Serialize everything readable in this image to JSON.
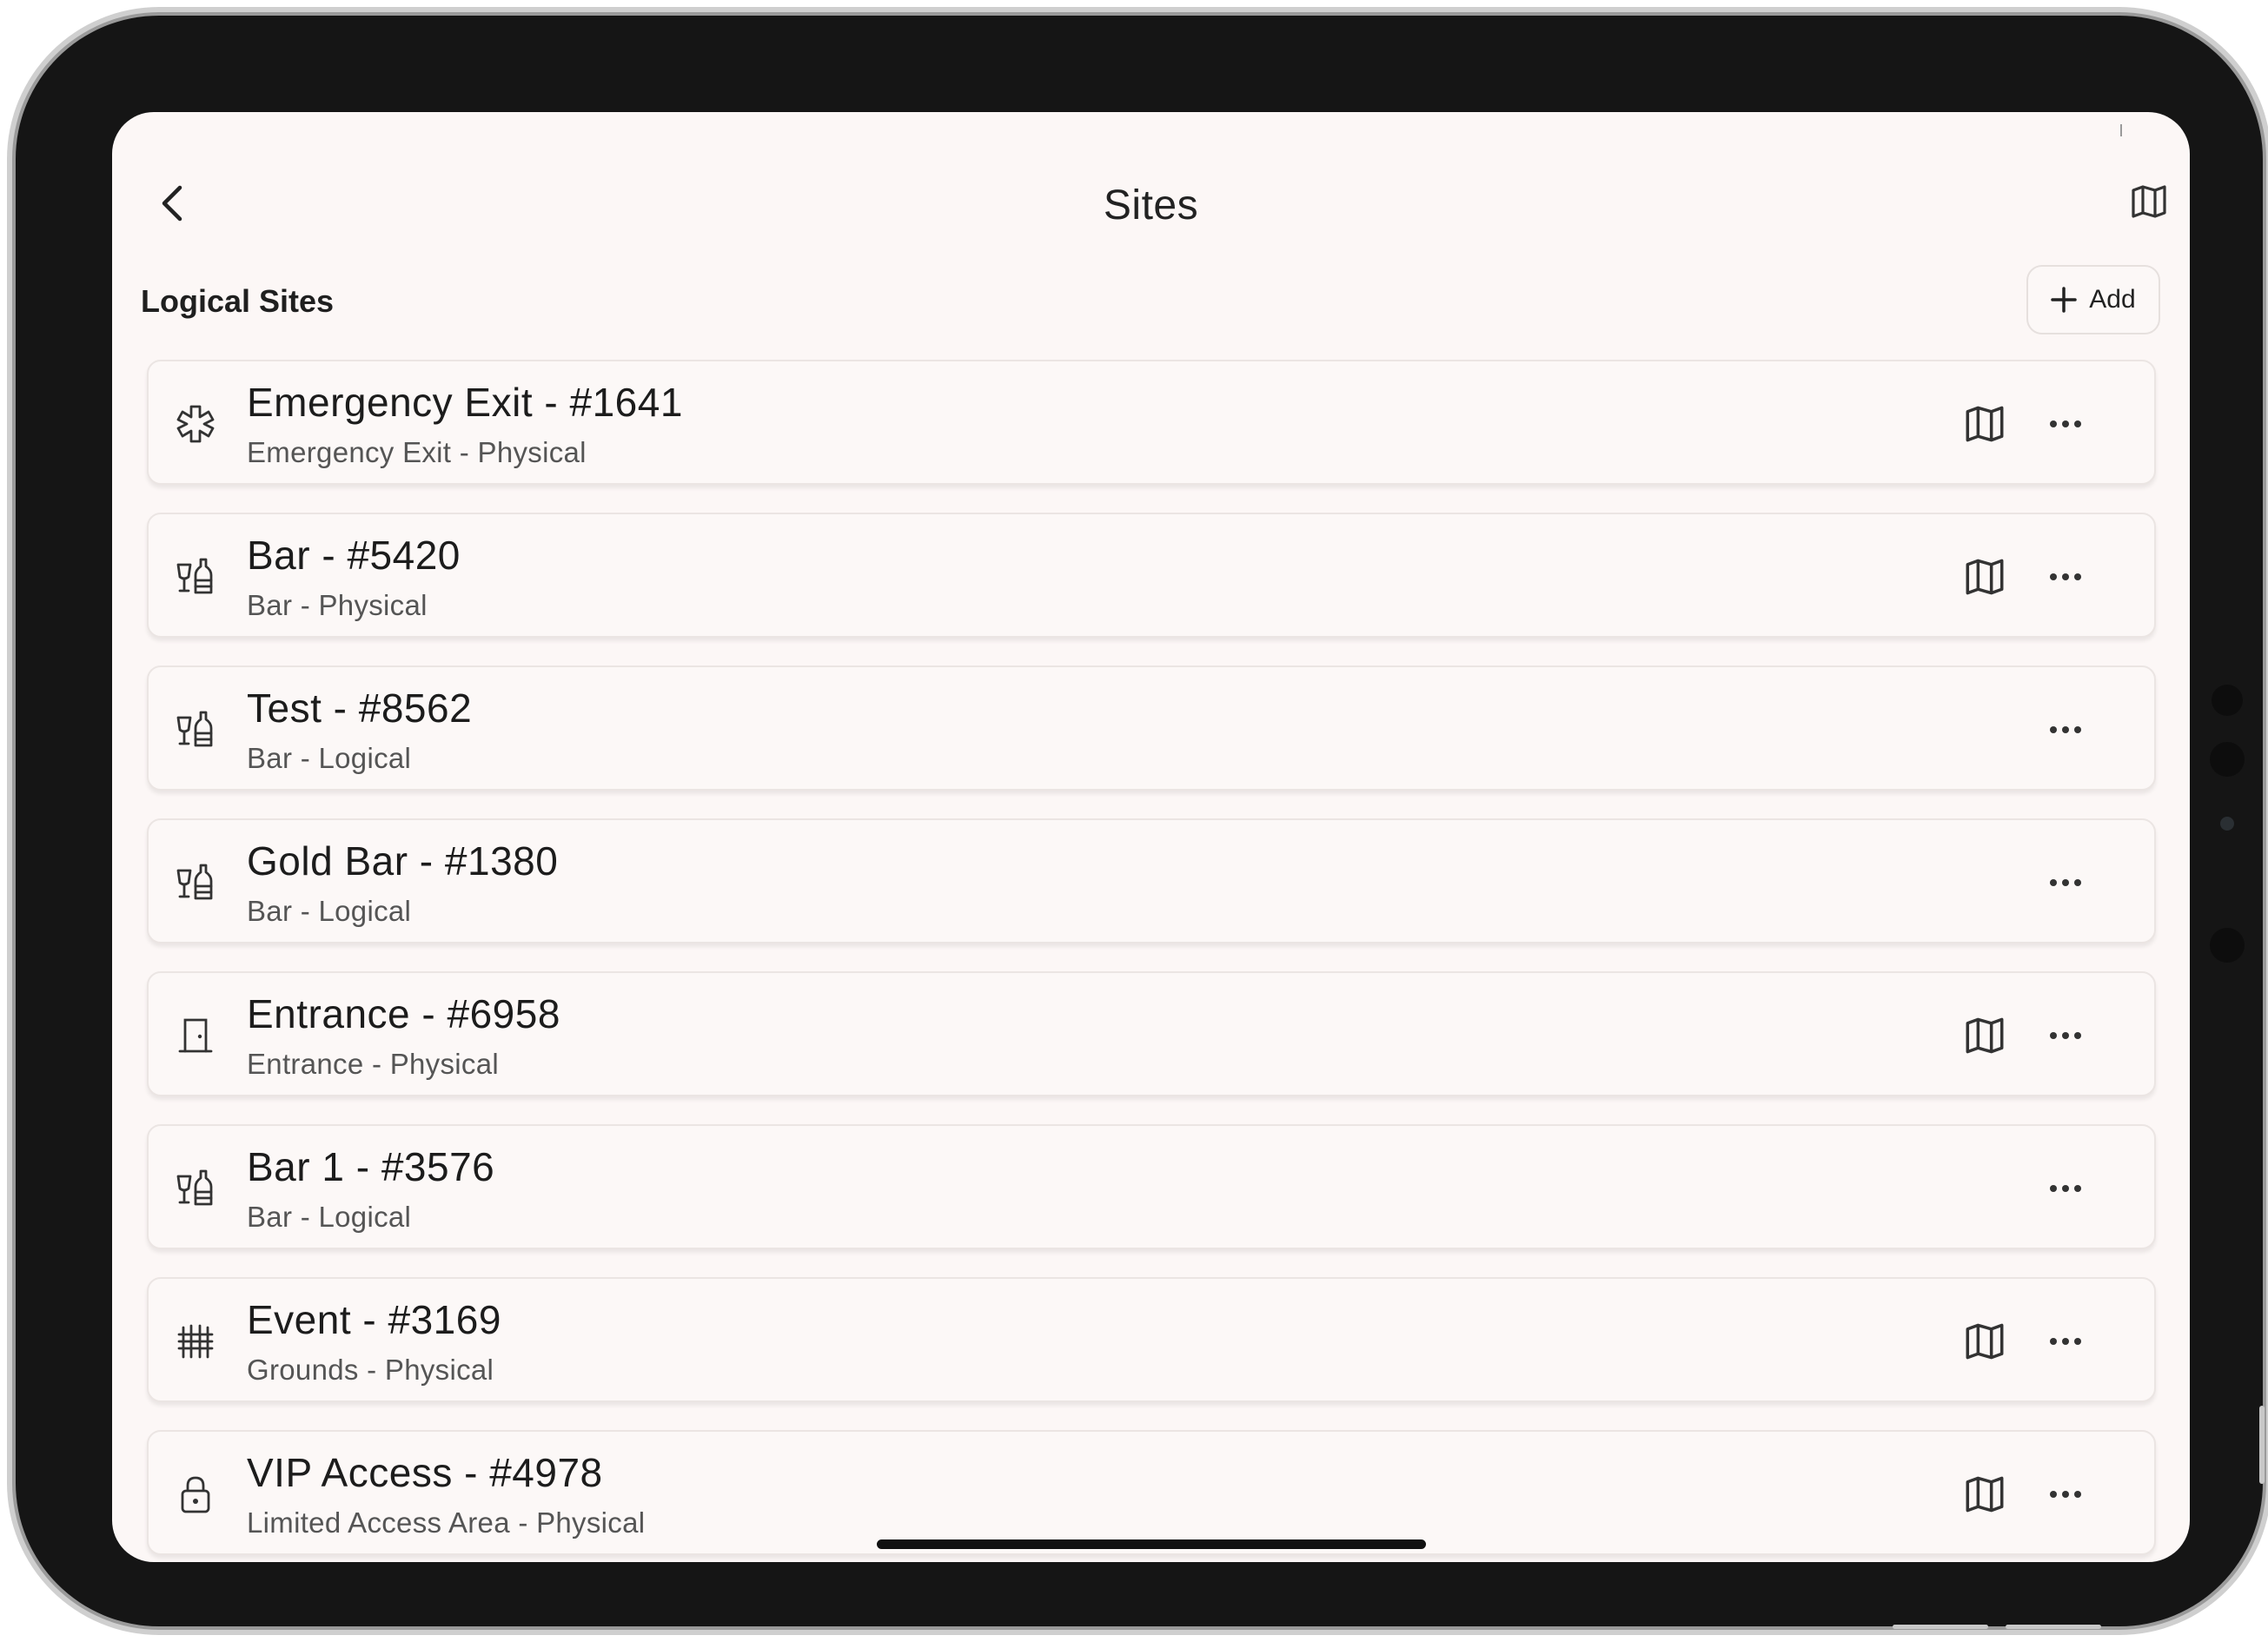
{
  "header": {
    "title": "Sites",
    "back_icon": "chevron-left-icon",
    "map_icon": "map-icon"
  },
  "section": {
    "title": "Logical Sites",
    "add_label": "Add"
  },
  "sites": [
    {
      "title": "Emergency Exit - #1641",
      "subtitle": "Emergency Exit - Physical",
      "icon": "medical-asterisk-icon",
      "has_map": true
    },
    {
      "title": "Bar - #5420",
      "subtitle": "Bar - Physical",
      "icon": "bar-drinks-icon",
      "has_map": true
    },
    {
      "title": "Test - #8562",
      "subtitle": "Bar - Logical",
      "icon": "bar-drinks-icon",
      "has_map": false
    },
    {
      "title": "Gold Bar - #1380",
      "subtitle": "Bar - Logical",
      "icon": "bar-drinks-icon",
      "has_map": false
    },
    {
      "title": "Entrance - #6958",
      "subtitle": "Entrance - Physical",
      "icon": "door-icon",
      "has_map": true
    },
    {
      "title": "Bar 1 - #3576",
      "subtitle": "Bar - Logical",
      "icon": "bar-drinks-icon",
      "has_map": false
    },
    {
      "title": "Event - #3169",
      "subtitle": "Grounds - Physical",
      "icon": "fence-grid-icon",
      "has_map": true
    },
    {
      "title": "VIP Access - #4978",
      "subtitle": "Limited Access Area - Physical",
      "icon": "lock-icon",
      "has_map": true
    }
  ],
  "colors": {
    "background": "#fcf7f6",
    "text": "#1c1c1c",
    "subtext": "#555555",
    "border": "#ebe5e3"
  }
}
